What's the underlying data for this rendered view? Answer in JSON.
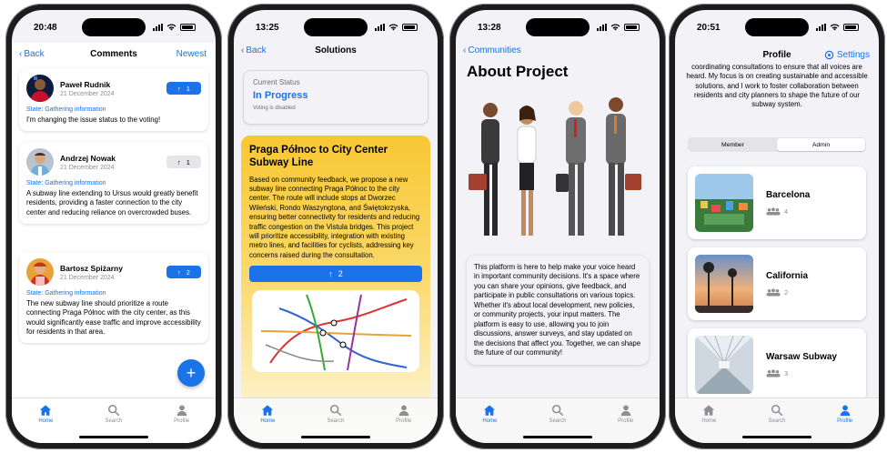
{
  "phone1": {
    "time": "20:48",
    "nav": {
      "back": "Back",
      "title": "Comments",
      "right": "Newest"
    },
    "comments": [
      {
        "name": "Paweł Rudnik",
        "date": "21 December 2024",
        "votes": "1",
        "state": "State: Gathering information",
        "text": "I'm changing the issue status to the voting!"
      },
      {
        "name": "Andrzej Nowak",
        "date": "21 December 2024",
        "votes": "1",
        "state": "State: Gathering information",
        "text": "A subway line extending to Ursus would greatly benefit residents, providing a faster connection to the city center and reducing reliance on overcrowded buses."
      },
      {
        "name": "Bartosz Spiżarny",
        "date": "21 December 2024",
        "votes": "2",
        "state": "State: Gathering information",
        "text": "The new subway line should prioritize a route connecting Praga Północ with the city center, as this would significantly ease traffic and improve accessibility for residents in that area."
      }
    ],
    "fab": "+",
    "active_tab": "Home"
  },
  "phone2": {
    "time": "13:25",
    "nav": {
      "back": "Back",
      "title": "Solutions"
    },
    "status": {
      "label": "Current Status",
      "value": "In Progress",
      "note": "Voting is disabled"
    },
    "solution": {
      "title": "Praga Północ to City Center Subway Line",
      "text": "Based on community feedback, we propose a new subway line connecting Praga Północ to the city center. The route will include stops at Dworzec Wileński, Rondo Waszyngtona, and Świętokrzyska, ensuring better connectivity for residents and reducing traffic congestion on the Vistula bridges. This project will prioritize accessibility, integration with existing metro lines, and facilities for cyclists, addressing key concerns raised during the consultation.",
      "votes": "2"
    },
    "active_tab": "Home"
  },
  "phone3": {
    "time": "13:28",
    "nav": {
      "back": "Communities"
    },
    "title": "About Project",
    "text": "This platform is here to help make your voice heard in important community decisions. It's a space where you can share your opinions, give feedback, and participate in public consultations on various topics. Whether it's about local development, new policies, or community projects, your input matters. The platform is easy to use, allowing you to join discussions, answer surveys, and stay updated on the decisions that affect you. Together, we can shape the future of our community!",
    "active_tab": "Home"
  },
  "phone4": {
    "time": "20:51",
    "nav": {
      "title": "Profile",
      "right": "Settings"
    },
    "bio": "coordinating consultations to ensure that all voices are heard. My focus is on creating sustainable and accessible solutions, and I work to foster collaboration between residents and city planners to shape the future of our subway system.",
    "segments": [
      "Member",
      "Admin"
    ],
    "selected_segment": "Admin",
    "communities": [
      {
        "name": "Barcelona",
        "count": "4"
      },
      {
        "name": "California",
        "count": "2"
      },
      {
        "name": "Warsaw Subway",
        "count": "3"
      }
    ],
    "active_tab": "Profile"
  },
  "tabs": [
    "Home",
    "Search",
    "Profile"
  ],
  "colors": {
    "accent": "#1a73e8",
    "solution_card": "#f8c733",
    "background": "#f2f2f7"
  }
}
